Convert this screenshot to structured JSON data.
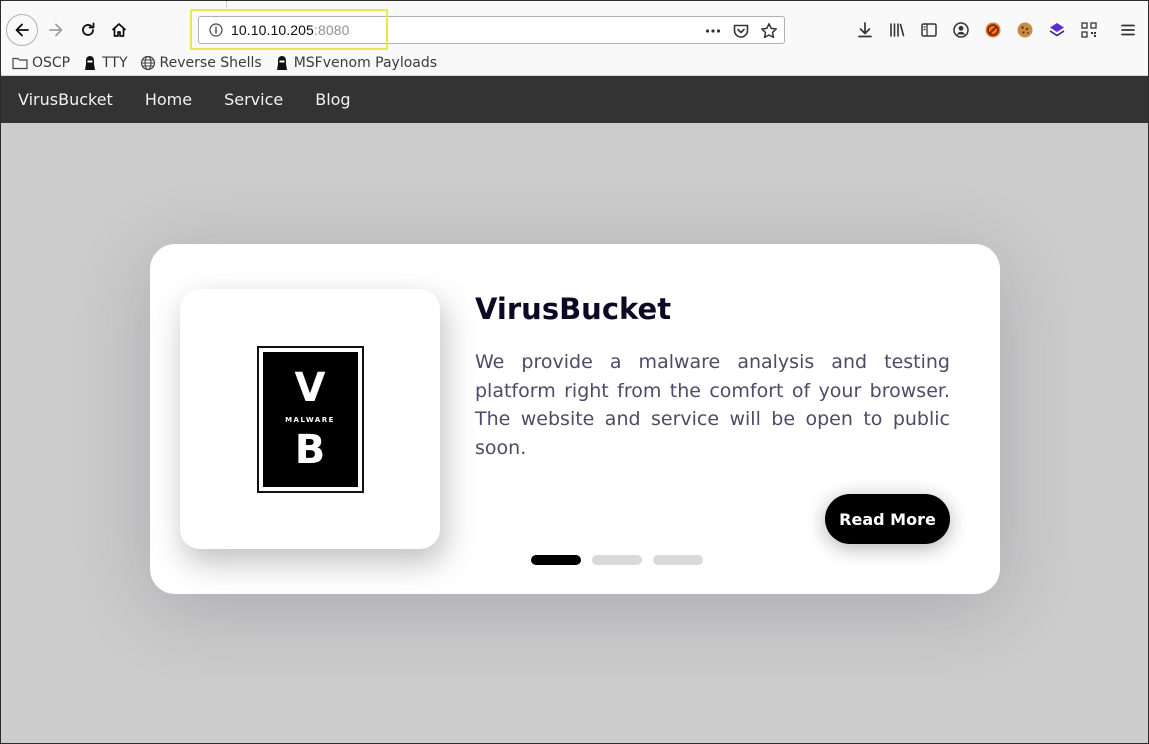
{
  "browser": {
    "url_host": "10.10.10.205",
    "url_port": ":8080",
    "bookmarks": [
      {
        "label": "OSCP",
        "icon": "folder-icon"
      },
      {
        "label": "TTY",
        "icon": "hacker-icon"
      },
      {
        "label": "Reverse Shells",
        "icon": "globe-icon"
      },
      {
        "label": "MSFvenom Payloads",
        "icon": "hacker-icon"
      }
    ]
  },
  "site": {
    "nav": {
      "brand": "VirusBucket",
      "items": [
        "Home",
        "Service",
        "Blog"
      ]
    },
    "card": {
      "logo": {
        "top": "V",
        "middle": "MALWARE",
        "bottom": "B"
      },
      "title": "VirusBucket",
      "description": "We provide a malware analysis and testing platform right from the comfort of your browser. The website and service will be open to public soon.",
      "button_label": "Read More",
      "slides": {
        "count": 3,
        "active": 1
      }
    }
  },
  "colors": {
    "nav_bg": "#333333",
    "page_bg": "#cccccc",
    "title": "#0d0925",
    "text": "#4e4a67",
    "button": "#000000",
    "url_highlight": "#e8e84f"
  }
}
